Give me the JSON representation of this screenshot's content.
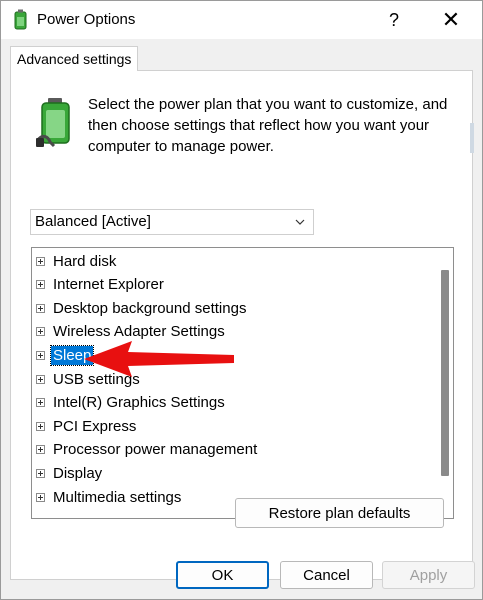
{
  "window": {
    "title": "Power Options",
    "help_label": "?",
    "close_label": "✕"
  },
  "tab": {
    "label": "Advanced settings"
  },
  "description": "Select the power plan that you want to customize, and then choose settings that reflect how you want your computer to manage power.",
  "plan_select": {
    "value": "Balanced [Active]"
  },
  "tree": {
    "items": [
      {
        "label": "Hard disk"
      },
      {
        "label": "Internet Explorer"
      },
      {
        "label": "Desktop background settings"
      },
      {
        "label": "Wireless Adapter Settings"
      },
      {
        "label": "Sleep",
        "selected": true
      },
      {
        "label": "USB settings"
      },
      {
        "label": "Intel(R) Graphics Settings"
      },
      {
        "label": "PCI Express"
      },
      {
        "label": "Processor power management"
      },
      {
        "label": "Display"
      },
      {
        "label": "Multimedia settings"
      }
    ]
  },
  "buttons": {
    "restore": "Restore plan defaults",
    "ok": "OK",
    "cancel": "Cancel",
    "apply": "Apply"
  },
  "colors": {
    "selection": "#0078d7",
    "annotation_arrow": "#e81010",
    "default_button_border": "#0067c0"
  }
}
